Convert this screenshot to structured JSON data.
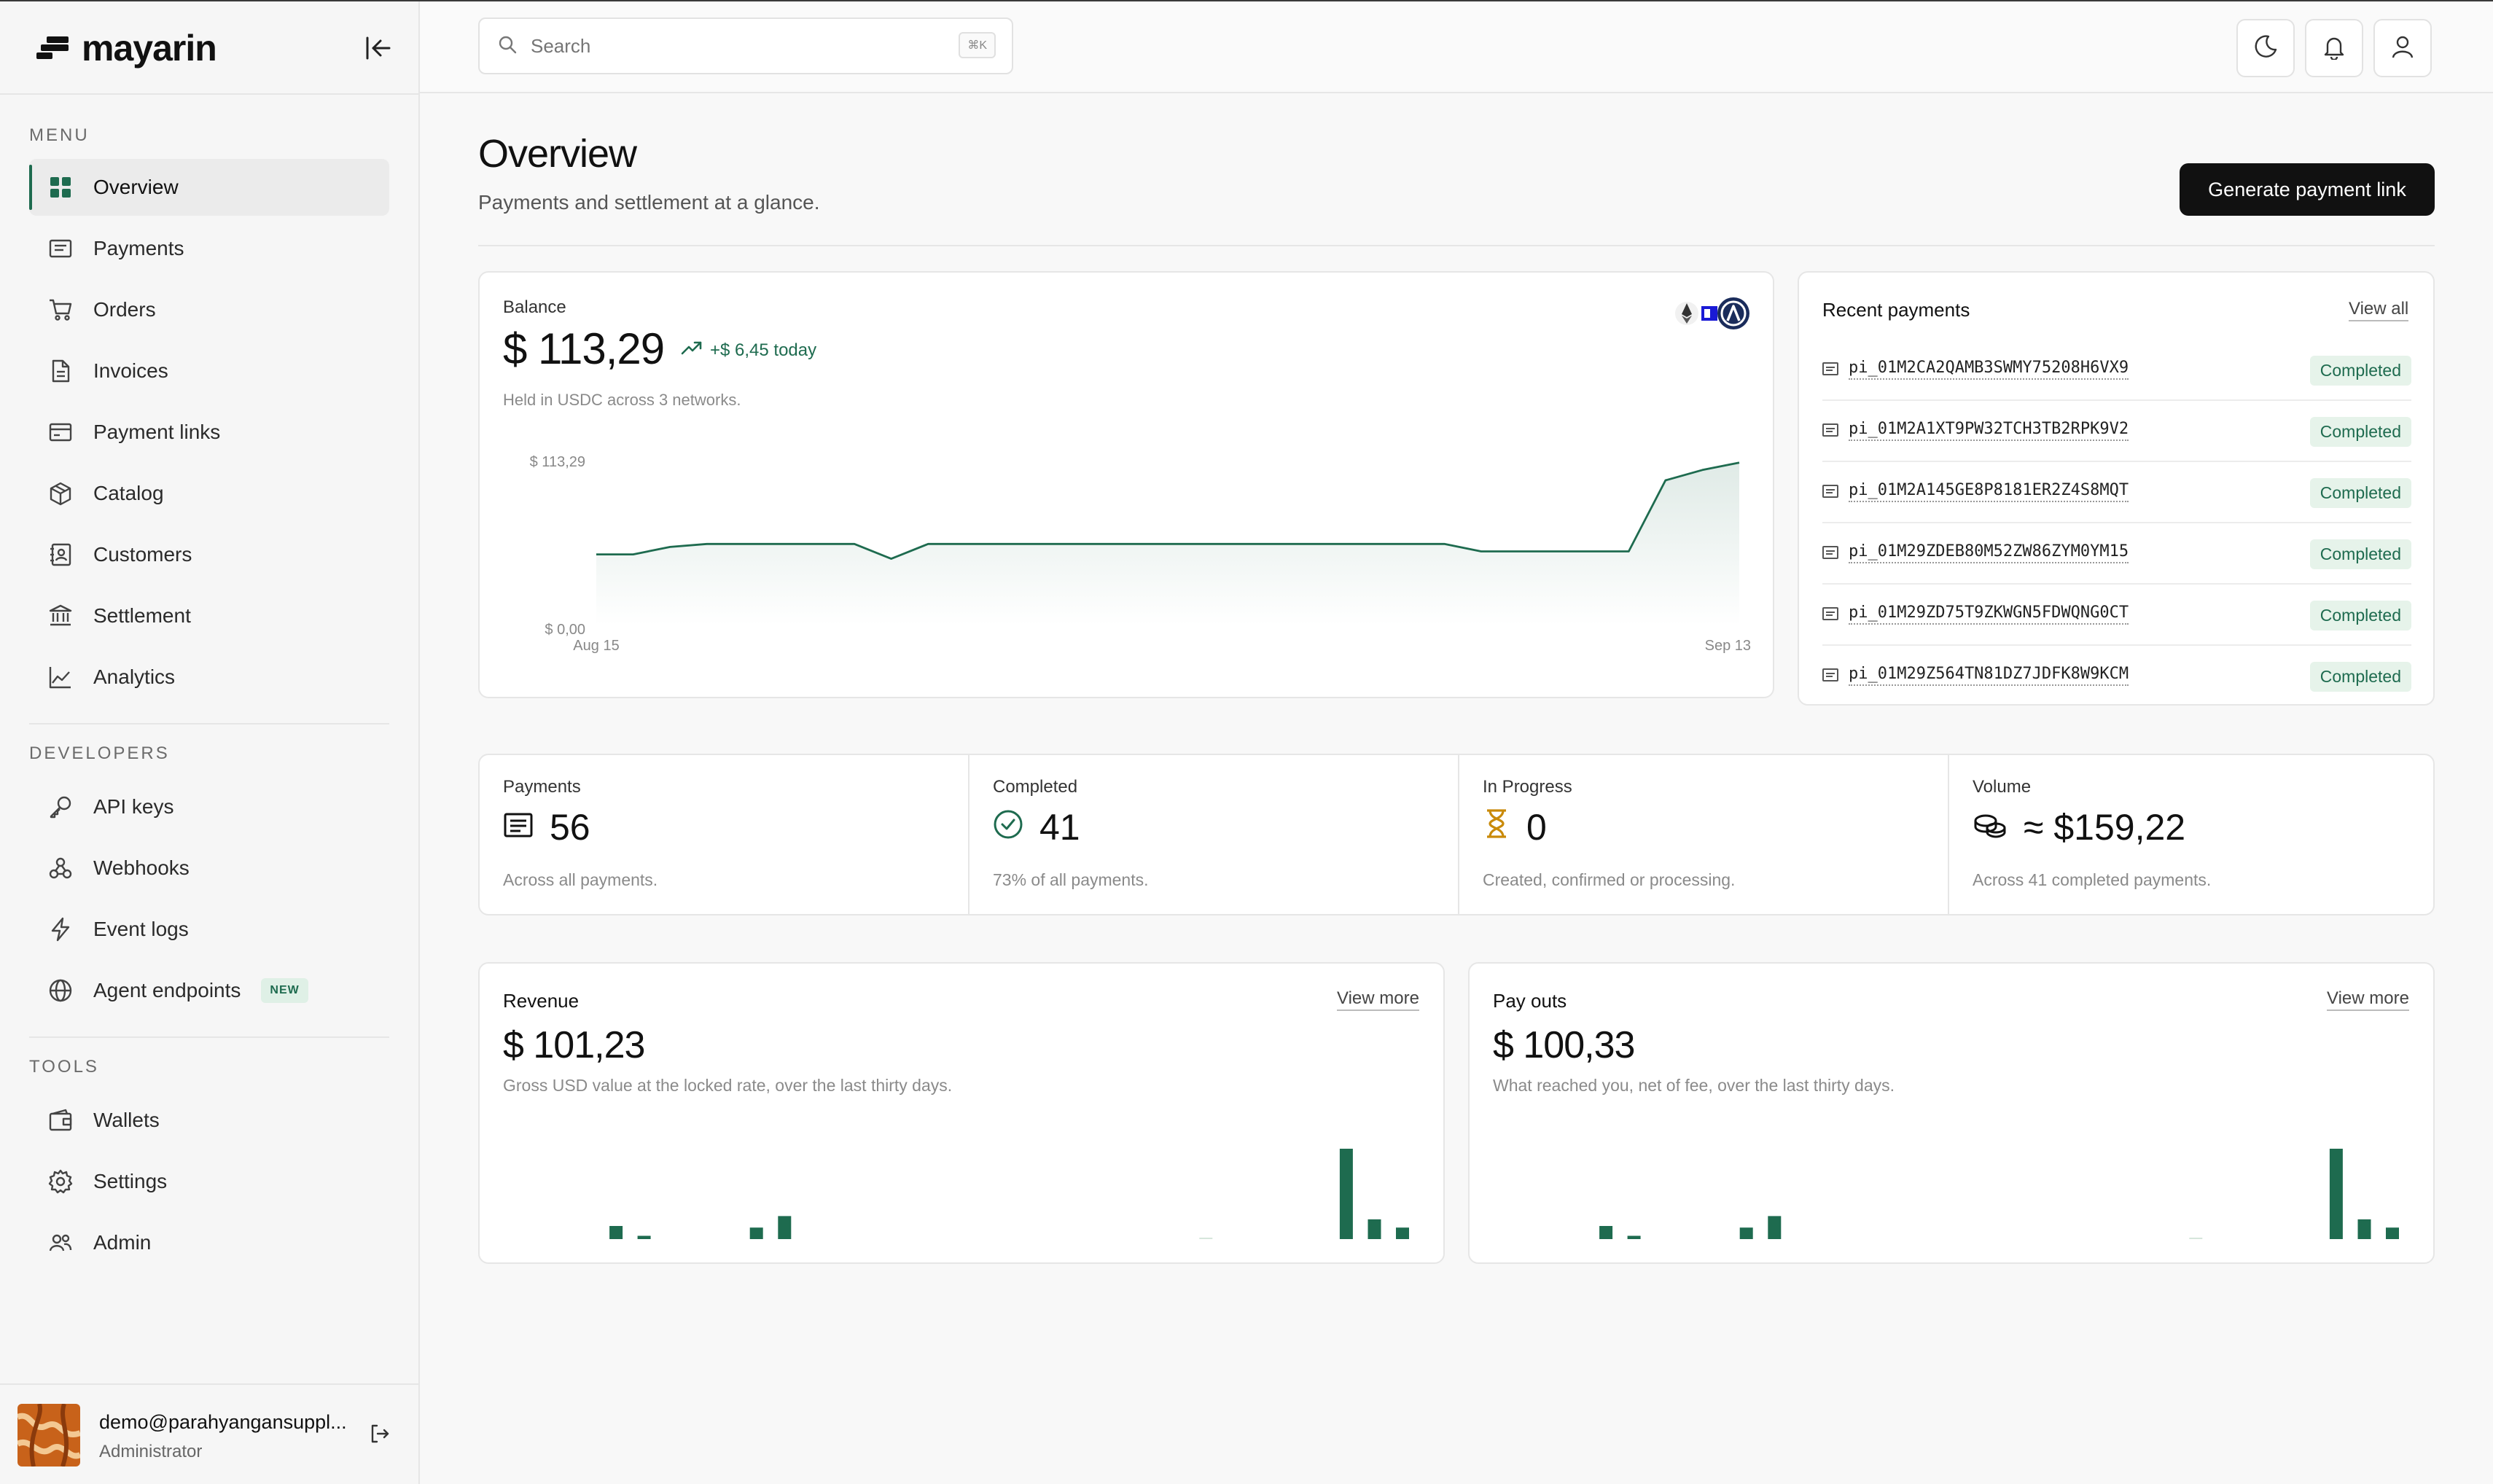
{
  "brand": {
    "name": "mayarin"
  },
  "sidebar": {
    "menu_label": "MENU",
    "menu_items": [
      {
        "label": "Overview",
        "icon": "grid-icon",
        "active": true
      },
      {
        "label": "Payments",
        "icon": "receipt-icon"
      },
      {
        "label": "Orders",
        "icon": "cart-icon"
      },
      {
        "label": "Invoices",
        "icon": "document-icon"
      },
      {
        "label": "Payment links",
        "icon": "card-link-icon"
      },
      {
        "label": "Catalog",
        "icon": "box-icon"
      },
      {
        "label": "Customers",
        "icon": "contacts-icon"
      },
      {
        "label": "Settlement",
        "icon": "bank-icon"
      },
      {
        "label": "Analytics",
        "icon": "line-chart-icon"
      }
    ],
    "developers_label": "DEVELOPERS",
    "developer_items": [
      {
        "label": "API keys",
        "icon": "key-icon"
      },
      {
        "label": "Webhooks",
        "icon": "webhook-icon"
      },
      {
        "label": "Event logs",
        "icon": "lightning-icon"
      },
      {
        "label": "Agent endpoints",
        "icon": "globe-icon",
        "badge": "NEW"
      }
    ],
    "tools_label": "TOOLS",
    "tool_items": [
      {
        "label": "Wallets",
        "icon": "wallet-icon"
      },
      {
        "label": "Settings",
        "icon": "gear-icon"
      },
      {
        "label": "Admin",
        "icon": "users-icon"
      }
    ],
    "user": {
      "email": "demo@parahyangansuppl...",
      "role": "Administrator"
    }
  },
  "topbar": {
    "search_placeholder": "Search",
    "shortcut": "⌘K"
  },
  "header": {
    "title": "Overview",
    "subtitle": "Payments and settlement at a glance.",
    "cta": "Generate payment link"
  },
  "balance": {
    "label": "Balance",
    "value": "$ 113,29",
    "delta": "+$ 6,45 today",
    "note": "Held in USDC across 3 networks.",
    "y_max_label": "$ 113,29",
    "y_min_label": "$ 0,00",
    "x_start_label": "Aug 15",
    "x_end_label": "Sep 13"
  },
  "recent": {
    "title": "Recent payments",
    "view_all": "View all",
    "rows": [
      {
        "id": "pi_01M2CA2QAMB3SWMY75208H6VX9",
        "status": "Completed"
      },
      {
        "id": "pi_01M2A1XT9PW32TCH3TB2RPK9V2",
        "status": "Completed"
      },
      {
        "id": "pi_01M2A145GE8P8181ER2Z4S8MQT",
        "status": "Completed"
      },
      {
        "id": "pi_01M29ZDEB80M52ZW86ZYM0YM15",
        "status": "Completed"
      },
      {
        "id": "pi_01M29ZD75T9ZKWGN5FDWQNG0CT",
        "status": "Completed"
      },
      {
        "id": "pi_01M29Z564TN81DZ7JDFK8W9KCM",
        "status": "Completed"
      }
    ]
  },
  "stats": [
    {
      "label": "Payments",
      "value": "56",
      "sub": "Across all payments.",
      "icon": "receipt-icon"
    },
    {
      "label": "Completed",
      "value": "41",
      "sub": "73% of all payments.",
      "icon": "check-circle-icon"
    },
    {
      "label": "In Progress",
      "value": "0",
      "sub": "Created, confirmed or processing.",
      "icon": "hourglass-icon"
    },
    {
      "label": "Volume",
      "value": "≈ $159,22",
      "sub": "Across 41 completed payments.",
      "icon": "coins-icon"
    }
  ],
  "revenue": {
    "title": "Revenue",
    "view_more": "View more",
    "value": "$ 101,23",
    "sub": "Gross USD value at the locked rate, over the last thirty days."
  },
  "payouts": {
    "title": "Pay outs",
    "view_more": "View more",
    "value": "$ 100,33",
    "sub": "What reached you, net of fee, over the last thirty days."
  },
  "colors": {
    "accent": "#1e6b4f",
    "accent_fill": "#e6f3ea",
    "primary_button": "#111111"
  },
  "chart_data": [
    {
      "type": "area",
      "title": "Balance",
      "x_labels": [
        "Aug 15",
        "Sep 13"
      ],
      "values": [
        48,
        48,
        53,
        55,
        55,
        55,
        55,
        55,
        45,
        55,
        55,
        55,
        55,
        55,
        55,
        55,
        55,
        55,
        55,
        55,
        55,
        55,
        55,
        55,
        50,
        50,
        50,
        50,
        50,
        98,
        105,
        110
      ],
      "ylim": [
        0,
        113.29
      ],
      "grid": false
    },
    {
      "type": "bar",
      "title": "Revenue",
      "values": [
        0,
        0,
        8,
        2,
        0,
        0,
        0,
        7,
        14,
        0,
        0,
        0,
        0,
        0,
        0,
        0,
        0,
        0,
        0,
        0,
        0,
        0,
        0,
        0.2,
        0,
        0,
        0,
        0,
        55,
        12,
        7
      ]
    },
    {
      "type": "bar",
      "title": "Pay outs",
      "values": [
        0,
        0,
        8,
        2,
        0,
        0,
        0,
        7,
        14,
        0,
        0,
        0,
        0,
        0,
        0,
        0,
        0,
        0,
        0,
        0,
        0,
        0,
        0,
        0.2,
        0,
        0,
        0,
        0,
        55,
        12,
        7
      ]
    }
  ]
}
